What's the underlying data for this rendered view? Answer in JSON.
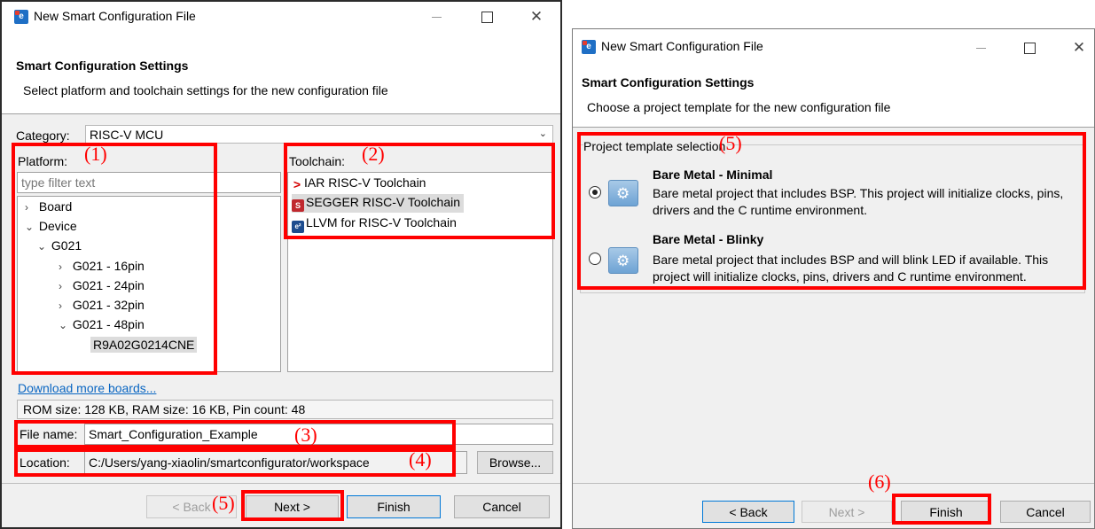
{
  "left": {
    "title": "New Smart Configuration File",
    "header_title": "Smart Configuration Settings",
    "header_desc": "Select platform and toolchain settings for the new configuration file",
    "category_label": "Category:",
    "category_value": "RISC-V MCU",
    "platform_label": "Platform:",
    "filter_placeholder": "type filter text",
    "tree": [
      {
        "label": "Board",
        "chevron": ">"
      },
      {
        "label": "Device",
        "chevron": "v"
      },
      {
        "label": "G021",
        "chevron": "v"
      },
      {
        "label": "G021 - 16pin",
        "chevron": ">"
      },
      {
        "label": "G021 - 24pin",
        "chevron": ">"
      },
      {
        "label": "G021 - 32pin",
        "chevron": ">"
      },
      {
        "label": "G021 - 48pin",
        "chevron": "v"
      },
      {
        "label": "R9A02G0214CNE",
        "chevron": ""
      }
    ],
    "toolchain_label": "Toolchain:",
    "toolchains": [
      {
        "label": "IAR RISC-V Toolchain",
        "icon": "arrow-icon"
      },
      {
        "label": "SEGGER RISC-V Toolchain",
        "icon": "segger-icon"
      },
      {
        "label": "LLVM for RISC-V Toolchain",
        "icon": "llvm-icon"
      }
    ],
    "download_link": "Download more boards...",
    "info": "ROM size: 128 KB, RAM size: 16 KB, Pin count: 48",
    "file_name_label": "File name:",
    "file_name_value": "Smart_Configuration_Example",
    "location_label": "Location:",
    "location_value": "C:/Users/yang-xiaolin/smartconfigurator/workspace",
    "browse": "Browse...",
    "back": "< Back",
    "next": "Next >",
    "finish": "Finish",
    "cancel": "Cancel"
  },
  "right": {
    "title": "New Smart Configuration File",
    "header_title": "Smart Configuration Settings",
    "header_desc": "Choose a project template for the new configuration file",
    "group_label": "Project template selection",
    "templates": [
      {
        "title": "Bare Metal - Minimal",
        "desc": "Bare metal project that includes BSP. This project will initialize clocks, pins, drivers and the C runtime environment.",
        "selected": true
      },
      {
        "title": "Bare Metal - Blinky",
        "desc": "Bare metal project that includes BSP and will blink LED if available. This project will initialize clocks, pins, drivers and C runtime environment.",
        "selected": false
      }
    ],
    "back": "< Back",
    "next": "Next >",
    "finish": "Finish",
    "cancel": "Cancel"
  },
  "annotations": {
    "a1": "(1)",
    "a2": "(2)",
    "a3": "(3)",
    "a4": "(4)",
    "a5": "(5)",
    "a5r": "(5)",
    "a6": "(6)"
  },
  "colors": {
    "annotation": "#ff0000",
    "link": "#0a66c2",
    "default_button_border": "#0078d7"
  }
}
